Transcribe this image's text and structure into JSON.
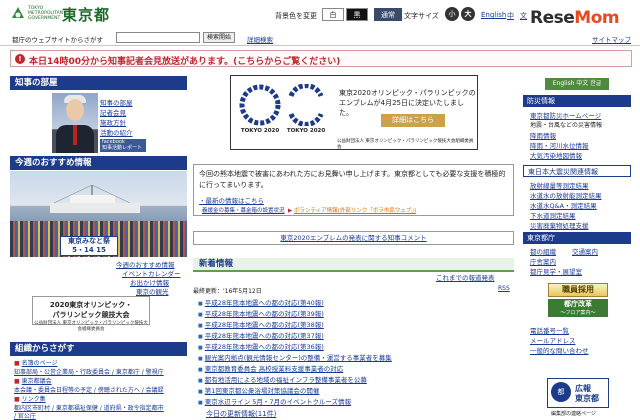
{
  "header": {
    "logo_en_1": "TOKYO",
    "logo_en_2": "METROPOLITAN",
    "logo_en_3": "GOVERNMENT",
    "logo_ja": "東京都",
    "bg_label": "背景色を変更",
    "bg_white": "白",
    "bg_black": "黒",
    "bg_normal": "通常",
    "fontsize_label": "文字サイズ",
    "fontsize_small": "小",
    "fontsize_large": "大",
    "lang_en": "English",
    "lang_zh": "中",
    "lang_ko": "文",
    "watermark_1": "Rese",
    "watermark_2": "Mom"
  },
  "search": {
    "label": "都庁のウェブサイトからさがす",
    "placeholder": "",
    "button": "検索開始",
    "detail": "詳細検索",
    "sitemap": "サイトマップ"
  },
  "alert": {
    "icon": "!",
    "text": "本日14時00分から知事記者会見放送があります。(こちらからご覧ください)"
  },
  "governor": {
    "heading": "知事の部屋",
    "links": [
      "知事の部屋",
      "記者会見",
      "施政方針",
      "活動の紹介"
    ],
    "fb_1": "facebook",
    "fb_2": "知事活動レポート"
  },
  "recommend": {
    "heading": "今週のおすすめ情報",
    "banner_1": "東京みなと祭",
    "banner_2": "5・14 15",
    "links": [
      "今週のおすすめ情報",
      "イベントカレンダー",
      "お出かけ情報",
      "東京の観光"
    ],
    "olympic_1": "2020東京オリンピック・",
    "olympic_2": "パラリンピック競技大会",
    "olympic_3": "公益財団法人 東京オリンピック・パラリンピック競技大会組織委員会"
  },
  "organization": {
    "heading": "組織からさがす",
    "rows": [
      "名簿のページ",
      "知事部局・公営企業局・行政委員会 / 東京都庁 / 警視庁",
      "東京都議会",
      "本会議・委員会日程等の予定 / 傍聴された方へ / 会議録",
      "リンク集",
      "都内区市町村 / 東京都福祉保健 / 道府県・政令指定都市",
      "  / 官公庁"
    ]
  },
  "emblem": {
    "label_1": "TOKYO 2020",
    "label_2": "TOKYO 2020",
    "title_1": "東京2020オリンピック・パラリンピックの",
    "title_2": "エンブレムが4月25日に決定いたしました。",
    "detail": "詳細はこちら",
    "footer": "公益財団法人 東京オリンピック・パラリンピック競技大会組織委員会"
  },
  "kumamoto": {
    "text": "今回の熊本地震で被害にあわれた方にお見舞い申し上げます。東京都としても必要な支援を積極的に行ってまいります。",
    "latest": "・最新の情報はこちら",
    "link_1": "義援金の募集・募金箱の設置状況",
    "link_2": "ボランティア情報(外部リンク「ボラ市民ウェブ」)"
  },
  "emblem_comment": "東京2020エンブレムの発表に関する知事コメント",
  "news": {
    "heading": "新着情報",
    "archive": "これまでの報道発表",
    "updated": "最終更新：'16年5月12日",
    "rss": "RSS",
    "items": [
      "平成28年熊本地震への都の対応(第40報)",
      "平成28年熊本地震への都の対応(第39報)",
      "平成28年熊本地震への都の対応(第38報)",
      "平成28年熊本地震への都の対応(第37報)",
      "平成28年熊本地震への都の対応(第36報)",
      "観光案内拠点(観光情報センター)の整備・運営する事業者を募集",
      "東京都教育委員会 高校授業料支援事業者の対応",
      "都有地活用による地域の福祉インフラ整備事業者を公募",
      "第1回東京都公衆浴場対策協議会の開催",
      "東京水辺ライン 5月・7月のイベントクルーズ情報"
    ],
    "more": "今日の更新情報(11件)"
  },
  "right": {
    "lang": "English 中文 한글",
    "disaster_heading": "防災情報",
    "disaster_links": [
      "東京都防災ホームページ",
      "地震・台風などの災害情報",
      "降雨情報",
      "降雨・河川水位情報",
      "大気汚染地図情報"
    ],
    "quake_heading": "東日本大震災関連情報",
    "quake_links": [
      "放射線量等測定結果",
      "水道水の放射能測定結果",
      "水道水Q&A・測定結果",
      "下水道測定結果",
      "災害廃棄物処理支援"
    ],
    "office_heading": "東京都庁",
    "office_links": [
      "都の組織",
      "交通案内",
      "庁舎案内",
      "都庁見学・展望室"
    ],
    "shokuin": "職員採用",
    "kaikaku_1": "都庁改革",
    "kaikaku_2": "〜フロア案内〜",
    "contact_links": [
      "電話番号一覧",
      "メールアドレス",
      "一般的な問い合わせ"
    ],
    "kouhou_circle": "都",
    "kouhou_1": "広報",
    "kouhou_2": "東京都",
    "kouhou_caption": "編集部の連絡ページ"
  }
}
